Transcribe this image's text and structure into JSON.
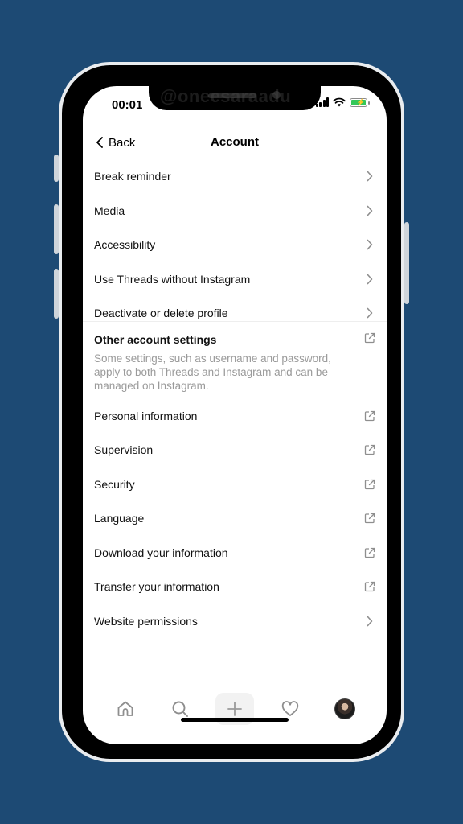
{
  "status": {
    "time": "00:01"
  },
  "watermark": "@oneesaraadu",
  "header": {
    "back_label": "Back",
    "title": "Account"
  },
  "menu_items": [
    {
      "label": "Break reminder",
      "icon": "chevron-right-icon"
    },
    {
      "label": "Media",
      "icon": "chevron-right-icon"
    },
    {
      "label": "Accessibility",
      "icon": "chevron-right-icon"
    },
    {
      "label": "Use Threads without Instagram",
      "icon": "chevron-right-icon"
    },
    {
      "label": "Deactivate or delete profile",
      "icon": "chevron-right-icon"
    }
  ],
  "other_settings": {
    "title": "Other account settings",
    "description": "Some settings, such as username and password, apply to both Threads and Instagram and can be managed on Instagram.",
    "items": [
      {
        "label": "Personal information",
        "icon": "external-link-icon"
      },
      {
        "label": "Supervision",
        "icon": "external-link-icon"
      },
      {
        "label": "Security",
        "icon": "external-link-icon"
      },
      {
        "label": "Language",
        "icon": "external-link-icon"
      },
      {
        "label": "Download your information",
        "icon": "external-link-icon"
      },
      {
        "label": "Transfer your information",
        "icon": "external-link-icon"
      },
      {
        "label": "Website permissions",
        "icon": "chevron-right-icon"
      }
    ]
  },
  "tabbar": [
    "home-icon",
    "search-icon",
    "plus-icon",
    "heart-icon",
    "profile-avatar"
  ],
  "colors": {
    "background": "#1d4a74",
    "battery": "#34c759"
  }
}
